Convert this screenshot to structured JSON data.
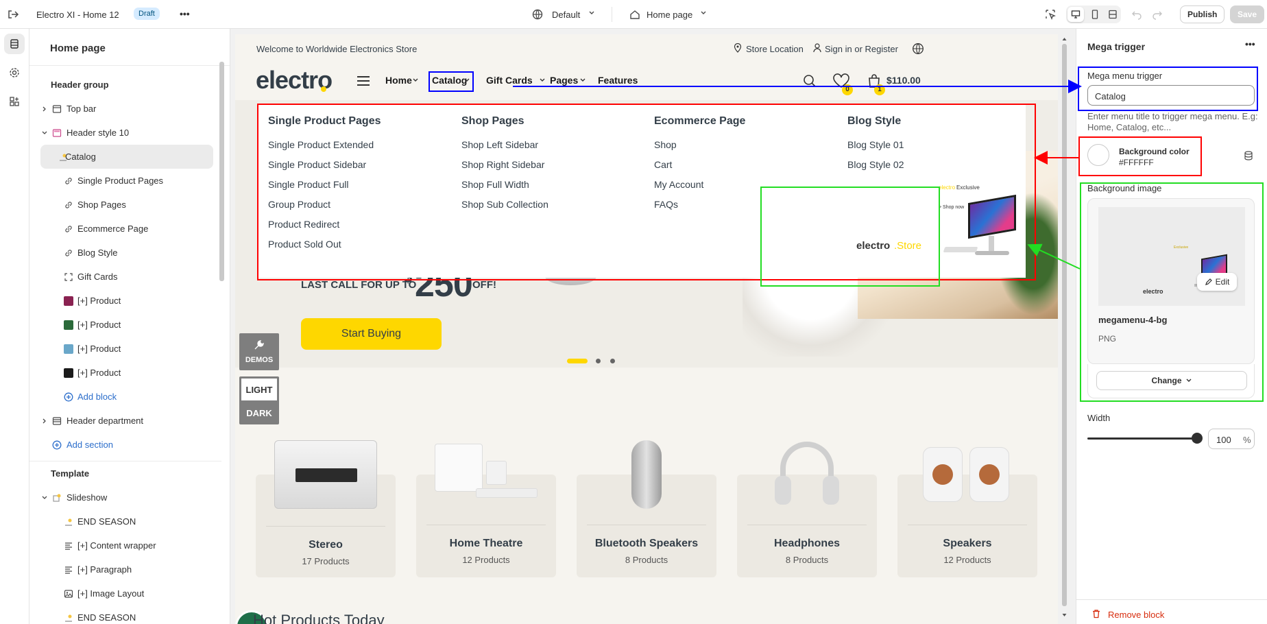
{
  "topbar": {
    "store_name": "Electro XI - Home 12",
    "status_badge": "Draft",
    "more_label": "•••",
    "theme_selector": "Default",
    "page_selector": "Home page",
    "publish_label": "Publish",
    "save_label": "Save"
  },
  "left_panel": {
    "title": "Home page",
    "header_group_label": "Header group",
    "items": [
      {
        "label": "Top bar"
      },
      {
        "label": "Header style 10"
      },
      {
        "label": "Catalog"
      },
      {
        "label": "Single Product Pages"
      },
      {
        "label": "Shop Pages"
      },
      {
        "label": "Ecommerce Page"
      },
      {
        "label": "Blog Style"
      },
      {
        "label": "Gift Cards"
      },
      {
        "label": "[+] Product"
      },
      {
        "label": "[+] Product"
      },
      {
        "label": "[+] Product"
      },
      {
        "label": "[+] Product"
      },
      {
        "label": "Add block"
      },
      {
        "label": "Header department"
      },
      {
        "label": "Add section"
      }
    ],
    "template_label": "Template",
    "template_items": [
      {
        "label": "Slideshow"
      },
      {
        "label": "END SEASON"
      },
      {
        "label": "[+] Content wrapper"
      },
      {
        "label": "[+] Paragraph"
      },
      {
        "label": "[+] Image Layout"
      },
      {
        "label": "END SEASON"
      }
    ]
  },
  "site": {
    "welcome": "Welcome to Worldwide Electronics Store",
    "store_location": "Store Location",
    "sign_in": "Sign in or Register",
    "logo": "electro",
    "nav": [
      "Home",
      "Catalog",
      "Gift Cards",
      "Pages",
      "Features"
    ],
    "wishlist_count": "0",
    "cart_count": "1",
    "cart_total": "$110.00",
    "mega_menu": [
      {
        "title": "Single Product Pages",
        "links": [
          "Single Product Extended",
          "Single Product Sidebar",
          "Single Product Full",
          "Group Product",
          "Product Redirect",
          "Product Sold Out"
        ]
      },
      {
        "title": "Shop Pages",
        "links": [
          "Shop Left Sidebar",
          "Shop Right Sidebar",
          "Shop Full Width",
          "Shop Sub Collection"
        ]
      },
      {
        "title": "Ecommerce Page",
        "links": [
          "Shop",
          "Cart",
          "My Account",
          "FAQs"
        ]
      },
      {
        "title": "Blog Style",
        "links": [
          "Blog Style 01",
          "Blog Style 02"
        ]
      }
    ],
    "promo_exclusive_brand": "electro",
    "promo_exclusive": "Exclusive",
    "promo_shop_now": "> Shop now",
    "promo_logo": "electro",
    "promo_logo_suffix": ".Store",
    "hero_prefix": "LAST CALL FOR UP TO",
    "hero_currency": "$",
    "hero_amount": "250",
    "hero_suffix": "OFF!",
    "hero_button": "Start Buying",
    "demos_label": "DEMOS",
    "light_label": "LIGHT",
    "dark_label": "DARK",
    "categories": [
      {
        "name": "Stereo",
        "count": "17 Products"
      },
      {
        "name": "Home Theatre",
        "count": "12 Products"
      },
      {
        "name": "Bluetooth Speakers",
        "count": "8 Products"
      },
      {
        "name": "Headphones",
        "count": "8 Products"
      },
      {
        "name": "Speakers",
        "count": "12 Products"
      }
    ],
    "hot_products": "Hot Products Today"
  },
  "right_panel": {
    "title": "Mega trigger",
    "more": "•••",
    "trigger_label": "Mega menu trigger",
    "trigger_value": "Catalog",
    "trigger_help": "Enter menu title to trigger mega menu. E.g: Home, Catalog, etc...",
    "bg_color_label": "Background color",
    "bg_color_value": "#FFFFFF",
    "bg_image_label": "Background image",
    "edit_label": "Edit",
    "image_name": "megamenu-4-bg",
    "image_type": "PNG",
    "change_label": "Change",
    "width_label": "Width",
    "width_value": "100",
    "width_unit": "%",
    "width_fraction": 1.0,
    "remove_label": "Remove block"
  },
  "colors": {
    "accent_yellow": "#fed700",
    "annotation_blue": "#0000ff",
    "annotation_red": "#ff0000",
    "annotation_green": "#22dd22",
    "remove_red": "#d72c0d"
  }
}
